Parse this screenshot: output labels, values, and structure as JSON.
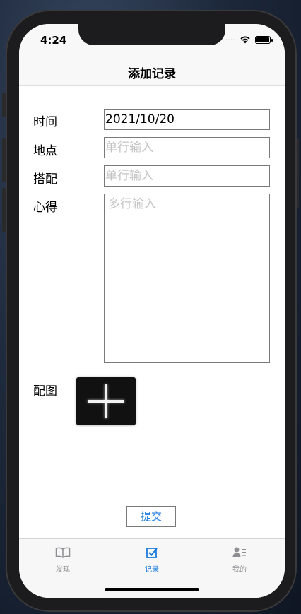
{
  "status_bar": {
    "time": "4:24",
    "signal_dots": "····"
  },
  "nav": {
    "title": "添加记录"
  },
  "form": {
    "time_label": "时间",
    "time_value": "2021/10/20",
    "place_label": "地点",
    "place_placeholder": "单行输入",
    "match_label": "搭配",
    "match_placeholder": "单行输入",
    "notes_label": "心得",
    "notes_placeholder": "多行输入",
    "photo_label": "配图",
    "submit_label": "提交"
  },
  "tabs": [
    {
      "label": "发现",
      "icon": "book-icon",
      "active": false
    },
    {
      "label": "记录",
      "icon": "checkbox-icon",
      "active": true
    },
    {
      "label": "我的",
      "icon": "profile-icon",
      "active": false
    }
  ],
  "colors": {
    "accent": "#1a7be0",
    "inactive": "#8e8e93"
  }
}
